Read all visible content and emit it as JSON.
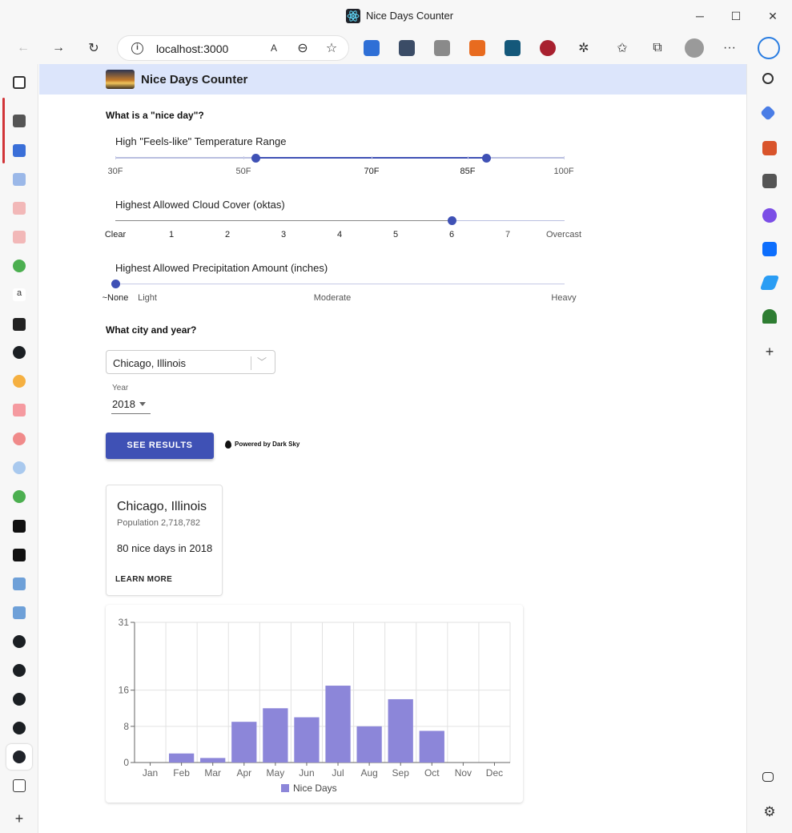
{
  "window": {
    "title": "Nice Days Counter",
    "controls": {
      "minimize": "─",
      "maximize": "☐",
      "close": "✕"
    }
  },
  "toolbar": {
    "url": "localhost:3000",
    "info": "i",
    "more": "···"
  },
  "app": {
    "title": "Nice Days Counter"
  },
  "criteria": {
    "heading": "What is a \"nice day\"?",
    "temperature": {
      "label": "High \"Feels-like\" Temperature Range",
      "marks": [
        "30F",
        "50F",
        "70F",
        "85F",
        "100F"
      ],
      "selected_range": [
        52,
        88
      ]
    },
    "cloud": {
      "label": "Highest Allowed Cloud Cover (oktas)",
      "marks": [
        "Clear",
        "1",
        "2",
        "3",
        "4",
        "5",
        "6",
        "7",
        "Overcast"
      ],
      "selected": "6"
    },
    "precip": {
      "label": "Highest Allowed Precipitation Amount (inches)",
      "marks": [
        "~None",
        "Light",
        "Moderate",
        "Heavy"
      ],
      "selected": "~None"
    }
  },
  "location": {
    "heading": "What city and year?",
    "city": "Chicago, Illinois",
    "year_label": "Year",
    "year": "2018"
  },
  "actions": {
    "see_results": "SEE RESULTS",
    "powered_by": "Powered by Dark Sky"
  },
  "result": {
    "city": "Chicago, Illinois",
    "population": "Population 2,718,782",
    "summary": "80 nice days in 2018",
    "learn_more": "LEARN MORE"
  },
  "chart_data": {
    "type": "bar",
    "categories": [
      "Jan",
      "Feb",
      "Mar",
      "Apr",
      "May",
      "Jun",
      "Jul",
      "Aug",
      "Sep",
      "Oct",
      "Nov",
      "Dec"
    ],
    "series": [
      {
        "name": "Nice Days",
        "values": [
          0,
          2,
          1,
          9,
          12,
          10,
          17,
          8,
          14,
          7,
          0,
          0
        ]
      }
    ],
    "yticks": [
      0,
      8,
      16,
      31
    ],
    "ylim": [
      0,
      31
    ],
    "grid": true,
    "legend": "bottom",
    "bar_color": "#8c86d9"
  },
  "colors": {
    "primary": "#3f51b5",
    "appbar": "#dce5fb",
    "bar": "#8c86d9"
  }
}
